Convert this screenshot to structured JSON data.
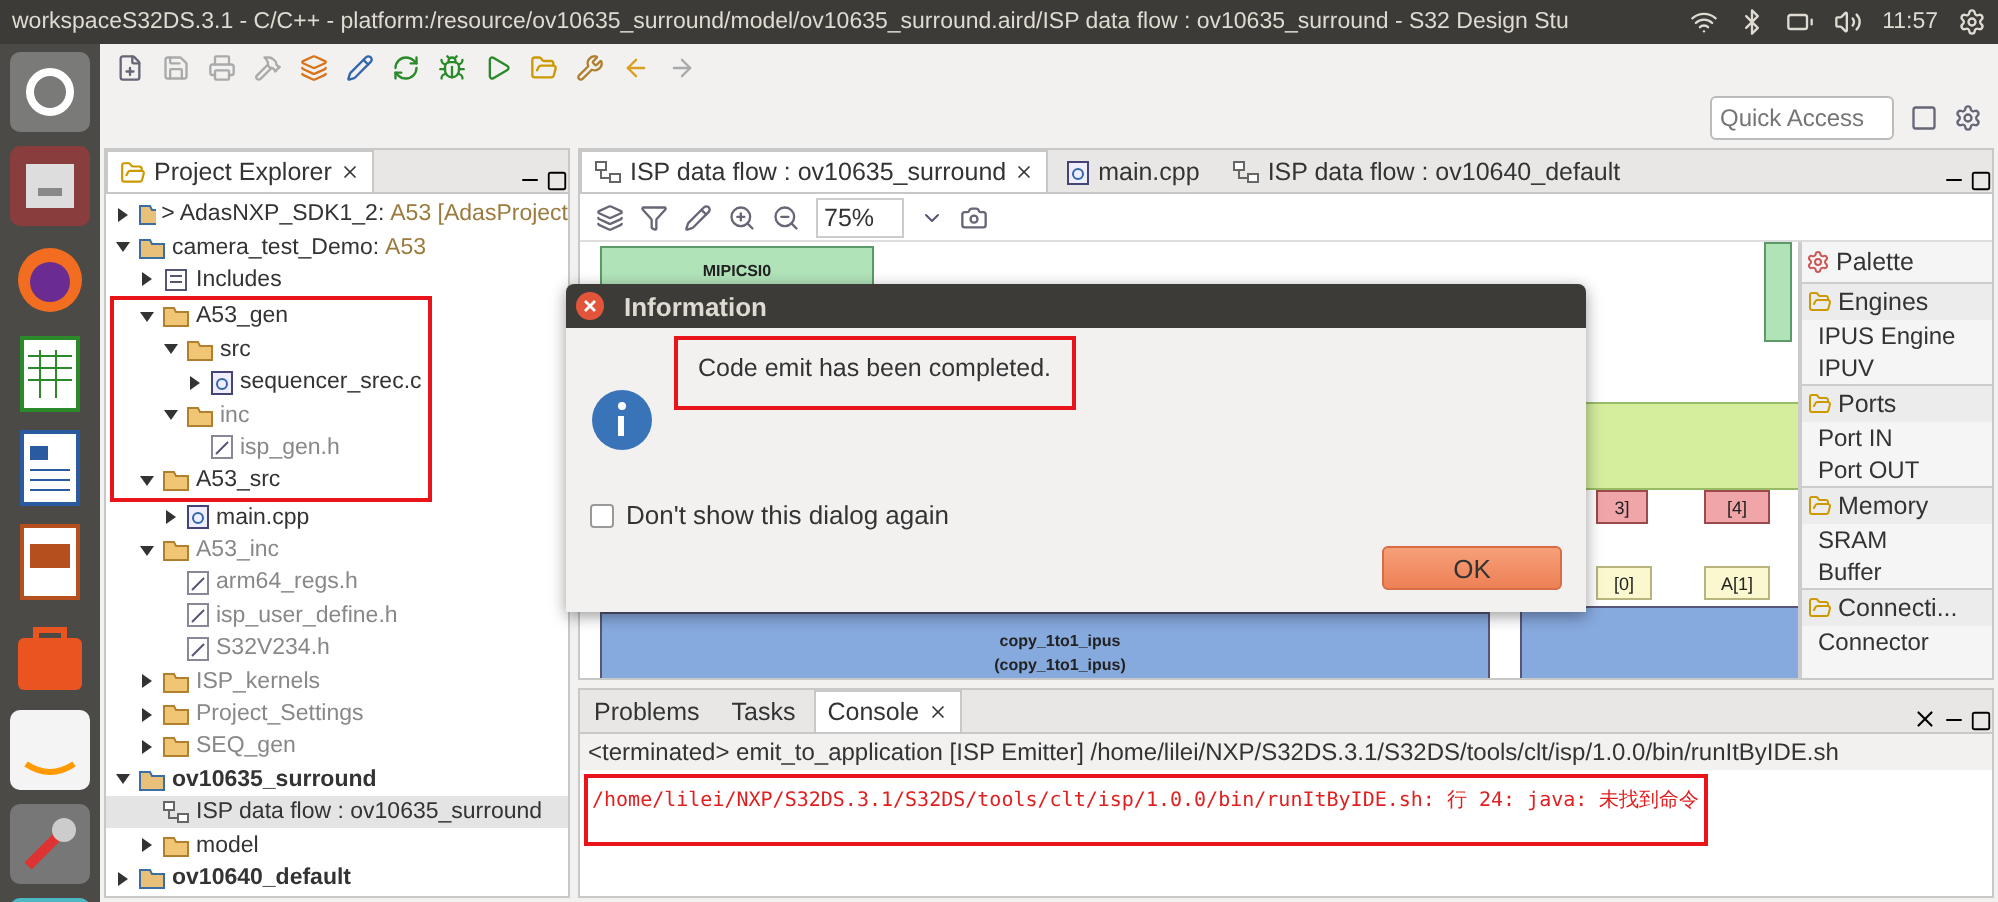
{
  "window": {
    "title": "workspaceS32DS.3.1 - C/C++ - platform:/resource/ov10635_surround/model/ov10635_surround.aird/ISP data flow : ov10635_surround - S32 Design Stu",
    "clock": "11:57"
  },
  "quick_access": {
    "placeholder": "Quick Access"
  },
  "explorer": {
    "title": "Project Explorer",
    "tree": [
      {
        "label": "> AdasNXP_SDK1_2:",
        "suffix": " A53 [AdasProject",
        "kind": "project",
        "expanded": false
      },
      {
        "label": "camera_test_Demo:",
        "suffix": " A53",
        "kind": "project",
        "expanded": true,
        "children": [
          {
            "label": "Includes",
            "kind": "includes",
            "expanded": false
          },
          {
            "label": "A53_gen",
            "kind": "folder",
            "expanded": true,
            "boxed": true,
            "children": [
              {
                "label": "src",
                "kind": "folder",
                "expanded": true,
                "children": [
                  {
                    "label": "sequencer_srec.c",
                    "kind": "file",
                    "expanded": false
                  }
                ]
              },
              {
                "label": "inc",
                "kind": "folder",
                "expanded": true,
                "dimmed": true,
                "children": [
                  {
                    "label": "isp_gen.h",
                    "kind": "header",
                    "dimmed": true
                  }
                ]
              }
            ]
          },
          {
            "label": "A53_src",
            "kind": "folder",
            "expanded": true,
            "boxed": true,
            "children": [
              {
                "label": "main.cpp",
                "kind": "file",
                "expanded": false,
                "boxed": false
              }
            ]
          },
          {
            "label": "A53_inc",
            "kind": "folder",
            "expanded": true,
            "dimmed": true,
            "children": [
              {
                "label": "arm64_regs.h",
                "kind": "header",
                "dimmed": true
              },
              {
                "label": "isp_user_define.h",
                "kind": "header",
                "dimmed": true
              },
              {
                "label": "S32V234.h",
                "kind": "header",
                "dimmed": true
              }
            ]
          },
          {
            "label": "ISP_kernels",
            "kind": "folder",
            "expanded": false,
            "dimmed": true
          },
          {
            "label": "Project_Settings",
            "kind": "folder",
            "expanded": false,
            "dimmed": true
          },
          {
            "label": "SEQ_gen",
            "kind": "folder",
            "expanded": false,
            "dimmed": true
          }
        ]
      },
      {
        "label": "ov10635_surround",
        "kind": "project",
        "expanded": true,
        "bold": true,
        "children": [
          {
            "label": "ISP data flow : ov10635_surround",
            "kind": "diagram",
            "selected": true
          },
          {
            "label": "model",
            "kind": "folder",
            "expanded": false
          }
        ]
      },
      {
        "label": "ov10640_default",
        "kind": "project",
        "expanded": false,
        "bold": true
      }
    ]
  },
  "editor": {
    "tabs": [
      {
        "label": "ISP data flow : ov10635_surround",
        "kind": "diagram",
        "selected": true
      },
      {
        "label": "main.cpp",
        "kind": "file",
        "selected": false
      },
      {
        "label": "ISP data flow : ov10640_default",
        "kind": "diagram",
        "selected": false
      }
    ],
    "zoom": "75%",
    "diagram": [
      {
        "kind": "engine",
        "label": "MIPICSI0"
      },
      {
        "kind": "buffer",
        "label": "3]"
      },
      {
        "kind": "buffer",
        "label": "[4]"
      },
      {
        "kind": "array",
        "label": "[0]"
      },
      {
        "kind": "array",
        "label": "A[1]"
      },
      {
        "kind": "kernel",
        "label": "copy_1to1_ipus"
      },
      {
        "kind": "kernel",
        "label": "(copy_1to1_ipus)"
      }
    ]
  },
  "palette": {
    "title": "Palette",
    "sections": [
      {
        "label": "Engines",
        "items": [
          "IPUS Engine",
          "IPUV"
        ]
      },
      {
        "label": "Ports",
        "items": [
          "Port IN",
          "Port OUT"
        ]
      },
      {
        "label": "Memory",
        "items": [
          "SRAM",
          "Buffer"
        ]
      },
      {
        "label": "Connecti...",
        "items": [
          "Connector"
        ]
      }
    ]
  },
  "console": {
    "tabs": [
      {
        "label": "Problems",
        "selected": false
      },
      {
        "label": "Tasks",
        "selected": false
      },
      {
        "label": "Console",
        "selected": true
      }
    ],
    "status": "<terminated> emit_to_application [ISP Emitter] /home/lilei/NXP/S32DS.3.1/S32DS/tools/clt/isp/1.0.0/bin/runItByIDE.sh",
    "lines": [
      {
        "text": "/home/lilei/NXP/S32DS.3.1/S32DS/tools/clt/isp/1.0.0/bin/runItByIDE.sh: 行 24: java: 未找到命令",
        "boxed": true
      }
    ]
  },
  "dialog": {
    "title": "Information",
    "message": "Code emit has been completed.",
    "message_boxed": true,
    "checkbox": {
      "label": "Don't show this dialog again",
      "checked": false
    },
    "button": "OK"
  }
}
